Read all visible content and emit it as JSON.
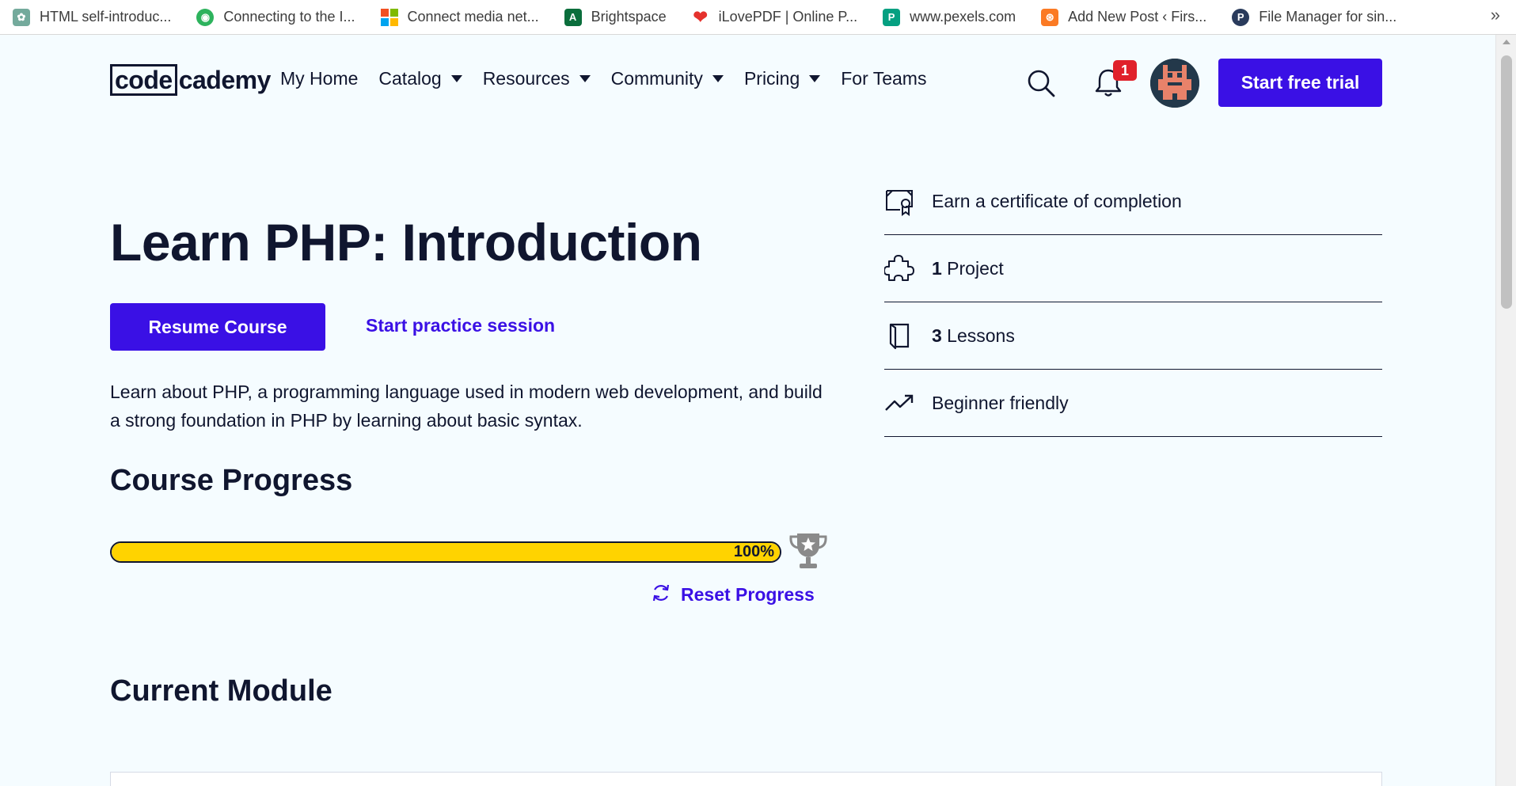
{
  "bookmarks": [
    {
      "label": "HTML self-introduc...",
      "icon": "chatgpt-icon",
      "color": "#74aa9c"
    },
    {
      "label": "Connecting to the I...",
      "icon": "headset-icon",
      "color": "#2db35d"
    },
    {
      "label": "Connect media net...",
      "icon": "microsoft-icon",
      "color": "#f25022"
    },
    {
      "label": "Brightspace",
      "icon": "brightspace-icon",
      "color": "#0a6e3c"
    },
    {
      "label": "iLovePDF | Online P...",
      "icon": "heart-icon",
      "color": "#e5322d"
    },
    {
      "label": "www.pexels.com",
      "icon": "pexels-icon",
      "color": "#05a081"
    },
    {
      "label": "Add New Post ‹ Firs...",
      "icon": "xampp-icon",
      "color": "#fb7a24"
    },
    {
      "label": "File Manager for sin...",
      "icon": "p-icon",
      "color": "#2a3b5c"
    }
  ],
  "bookmarks_more": "»",
  "header": {
    "logo_code": "code",
    "logo_cademy": "cademy",
    "nav": [
      {
        "label": "My Home",
        "caret": false
      },
      {
        "label": "Catalog",
        "caret": true
      },
      {
        "label": "Resources",
        "caret": true
      },
      {
        "label": "Community",
        "caret": true
      },
      {
        "label": "Pricing",
        "caret": true
      },
      {
        "label": "For Teams",
        "caret": false
      }
    ],
    "notification_count": "1",
    "cta_label": "Start free trial"
  },
  "course": {
    "title": "Learn PHP: Introduction",
    "resume_label": "Resume Course",
    "practice_label": "Start practice session",
    "description": "Learn about PHP, a programming language used in modern web development, and build a strong foundation in PHP by learning about basic syntax.",
    "progress_heading": "Course Progress",
    "progress_value": 1.0,
    "progress_text": "100%",
    "reset_label": "Reset Progress",
    "current_module_heading": "Current Module"
  },
  "features": [
    {
      "icon": "certificate-icon",
      "bold": "",
      "text": "Earn a certificate of completion"
    },
    {
      "icon": "puzzle-icon",
      "bold": "1",
      "text": " Project"
    },
    {
      "icon": "book-icon",
      "bold": "3",
      "text": " Lessons"
    },
    {
      "icon": "trending-up-icon",
      "bold": "",
      "text": "Beginner friendly"
    }
  ],
  "colors": {
    "accent": "#3a10e5",
    "progress_fill": "#ffd300",
    "badge": "#e0212b",
    "background": "#f5fcff",
    "text": "#10162f"
  }
}
